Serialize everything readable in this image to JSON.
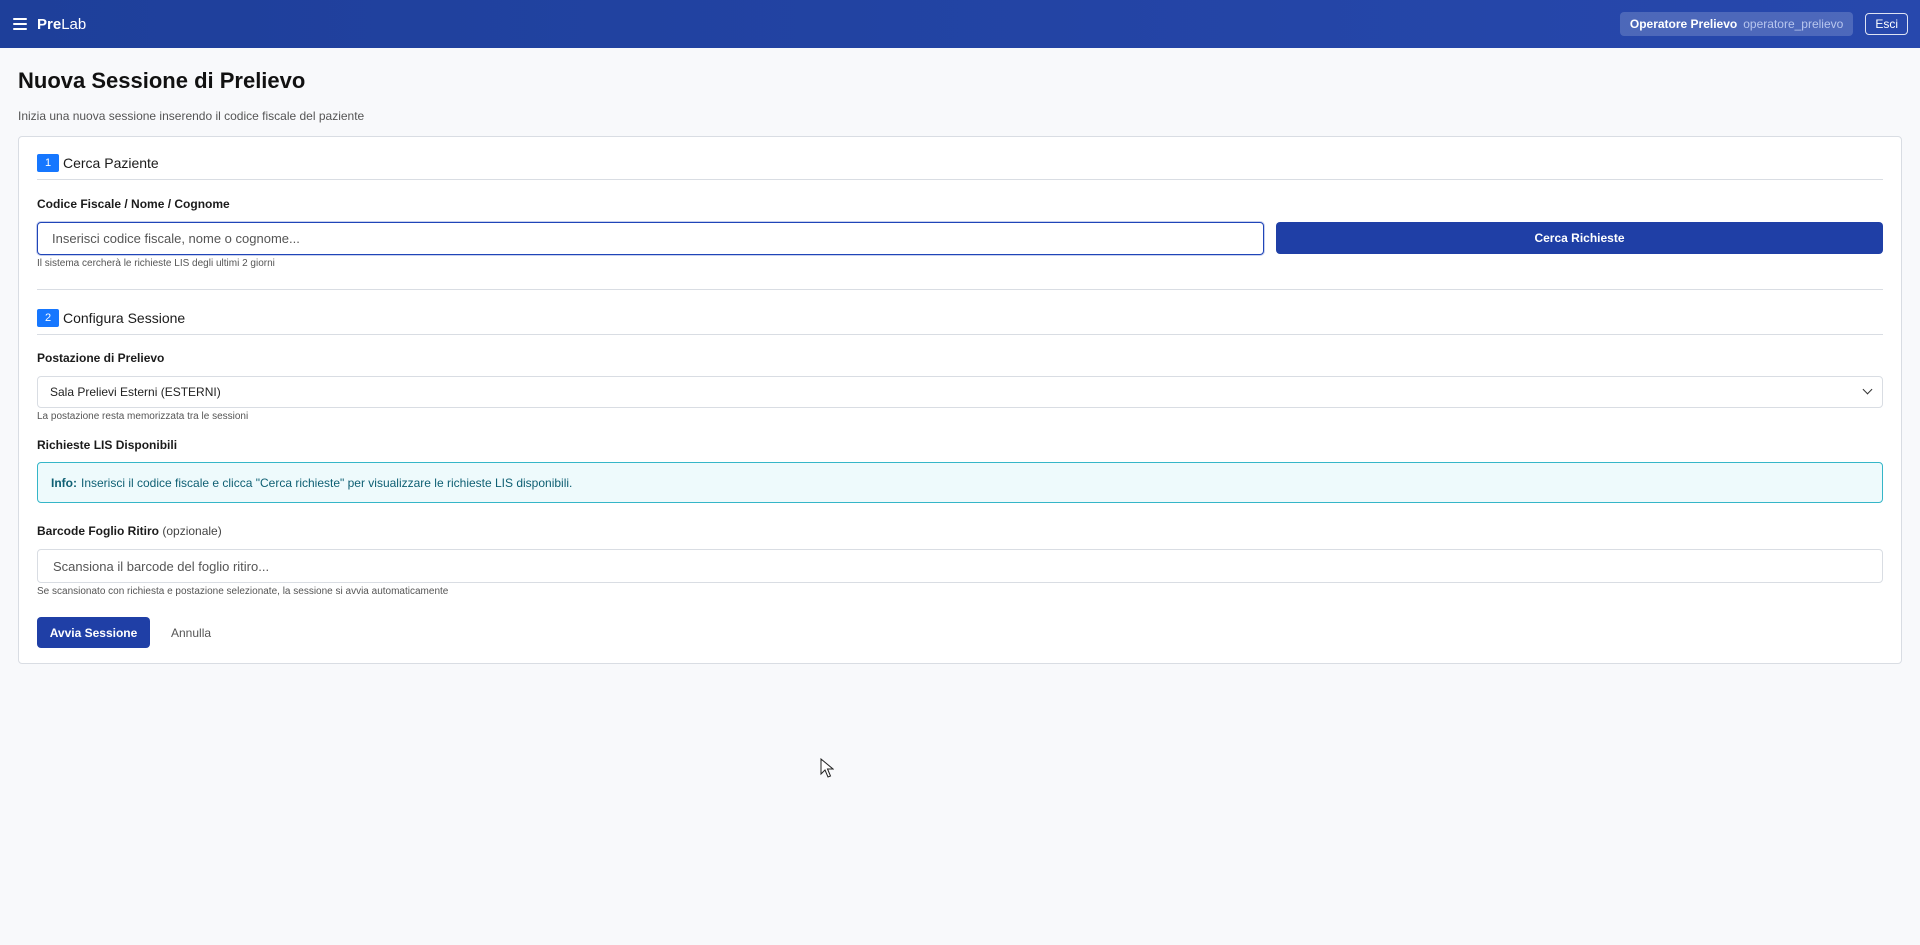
{
  "topbar": {
    "brand_bold": "Pre",
    "brand_rest": "Lab",
    "user_role": "Operatore Prelievo",
    "user_login": "operatore_prelievo",
    "logout_label": "Esci"
  },
  "page": {
    "title": "Nuova Sessione di Prelievo",
    "subtitle": "Inizia una nuova sessione inserendo il codice fiscale del paziente"
  },
  "step1": {
    "number": "1",
    "title": "Cerca Paziente",
    "field_label": "Codice Fiscale / Nome / Cognome",
    "input_placeholder": "Inserisci codice fiscale, nome o cognome...",
    "input_value": "",
    "search_button": "Cerca Richieste",
    "help": "Il sistema cercherà le richieste LIS degli ultimi 2 giorni"
  },
  "step2": {
    "number": "2",
    "title": "Configura Sessione",
    "station_label": "Postazione di Prelievo",
    "station_selected": "Sala Prelievi Esterni (ESTERNI)",
    "station_help": "La postazione resta memorizzata tra le sessioni",
    "requests_label": "Richieste LIS Disponibili",
    "info_prefix": "Info:",
    "info_text": "Inserisci il codice fiscale e clicca \"Cerca richieste\" per visualizzare le richieste LIS disponibili.",
    "barcode_label": "Barcode Foglio Ritiro",
    "barcode_optional": "(opzionale)",
    "barcode_placeholder": "Scansiona il barcode del foglio ritiro...",
    "barcode_help": "Se scansionato con richiesta e postazione selezionate, la sessione si avvia automaticamente"
  },
  "actions": {
    "start_label": "Avvia Sessione",
    "cancel_label": "Annulla"
  },
  "colors": {
    "topbar": "#2748ad",
    "primary": "#1f3fa6",
    "step_badge": "#1677ff",
    "info_border": "#35b6c8",
    "info_bg": "#eefafc"
  }
}
